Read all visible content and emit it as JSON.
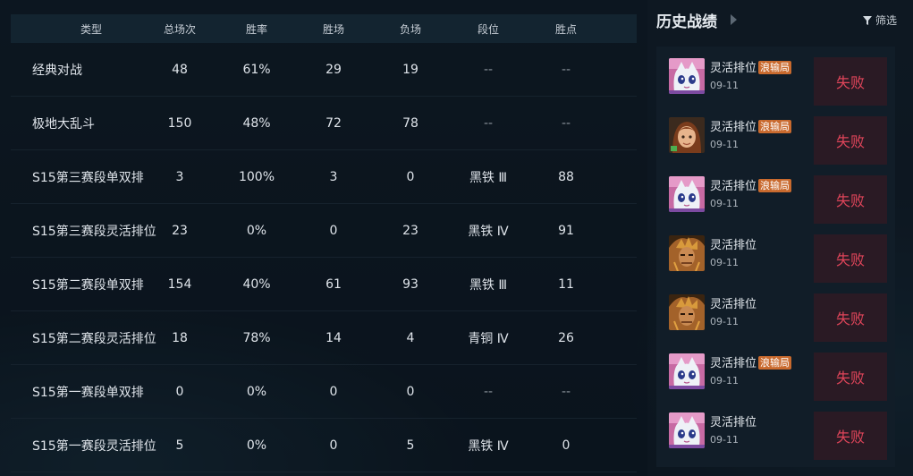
{
  "stats": {
    "headers": [
      "类型",
      "总场次",
      "胜率",
      "胜场",
      "负场",
      "段位",
      "胜点"
    ],
    "rows": [
      {
        "type": "经典对战",
        "total": "48",
        "rate": "61%",
        "win": "29",
        "loss": "19",
        "tier": "--",
        "lp": "--"
      },
      {
        "type": "极地大乱斗",
        "total": "150",
        "rate": "48%",
        "win": "72",
        "loss": "78",
        "tier": "--",
        "lp": "--"
      },
      {
        "type": "S15第三赛段单双排",
        "total": "3",
        "rate": "100%",
        "win": "3",
        "loss": "0",
        "tier": "黑铁 Ⅲ",
        "lp": "88"
      },
      {
        "type": "S15第三赛段灵活排位",
        "total": "23",
        "rate": "0%",
        "win": "0",
        "loss": "23",
        "tier": "黑铁 Ⅳ",
        "lp": "91"
      },
      {
        "type": "S15第二赛段单双排",
        "total": "154",
        "rate": "40%",
        "win": "61",
        "loss": "93",
        "tier": "黑铁 Ⅲ",
        "lp": "11"
      },
      {
        "type": "S15第二赛段灵活排位",
        "total": "18",
        "rate": "78%",
        "win": "14",
        "loss": "4",
        "tier": "青铜 Ⅳ",
        "lp": "26"
      },
      {
        "type": "S15第一赛段单双排",
        "total": "0",
        "rate": "0%",
        "win": "0",
        "loss": "0",
        "tier": "--",
        "lp": "--"
      },
      {
        "type": "S15第一赛段灵活排位",
        "total": "5",
        "rate": "0%",
        "win": "0",
        "loss": "5",
        "tier": "黑铁 Ⅳ",
        "lp": "0"
      }
    ]
  },
  "history": {
    "title": "历史战绩",
    "filter_label": "筛选",
    "matches": [
      {
        "queue": "灵活排位",
        "badge": "浪输局",
        "date": "09-11",
        "result": "失败",
        "champion_icon": "cat-champion-icon"
      },
      {
        "queue": "灵活排位",
        "badge": "浪输局",
        "date": "09-11",
        "result": "失败",
        "champion_icon": "girl-champion-icon"
      },
      {
        "queue": "灵活排位",
        "badge": "浪输局",
        "date": "09-11",
        "result": "失败",
        "champion_icon": "cat-champion-icon"
      },
      {
        "queue": "灵活排位",
        "badge": "",
        "date": "09-11",
        "result": "失败",
        "champion_icon": "warrior-champion-icon"
      },
      {
        "queue": "灵活排位",
        "badge": "",
        "date": "09-11",
        "result": "失败",
        "champion_icon": "warrior-champion-icon"
      },
      {
        "queue": "灵活排位",
        "badge": "浪输局",
        "date": "09-11",
        "result": "失败",
        "champion_icon": "cat-champion-icon"
      },
      {
        "queue": "灵活排位",
        "badge": "",
        "date": "09-11",
        "result": "失败",
        "champion_icon": "cat-champion-icon"
      }
    ]
  },
  "colors": {
    "loss_text": "#e0455a",
    "loss_bg": "#2a1a24",
    "badge_bg": "#c96a2e",
    "header_bg": "#132430"
  }
}
